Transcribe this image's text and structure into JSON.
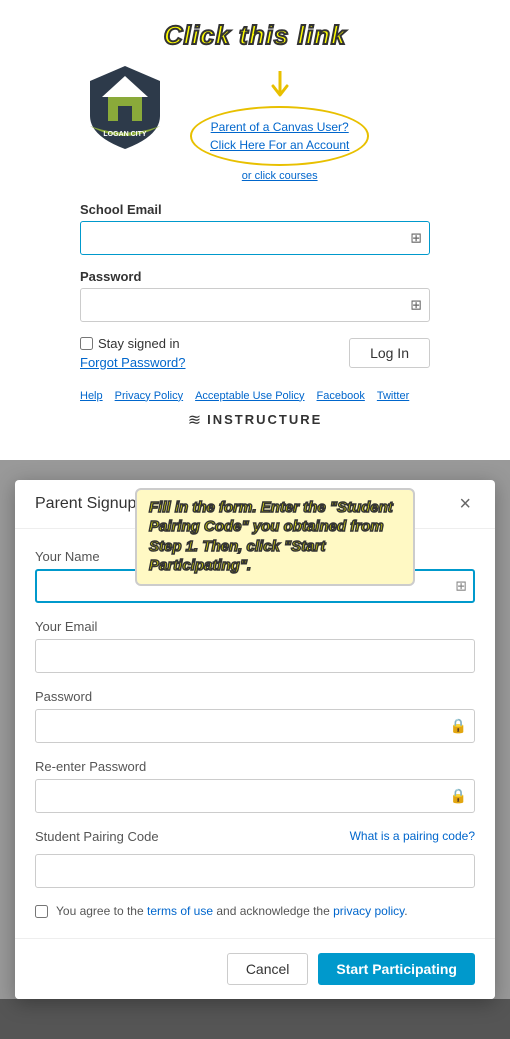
{
  "annotation": {
    "click_link": "Click this link",
    "fill_form": "Fill in the form. Enter the \"Student Pairing Code\" you obtained from Step 1. Then, click \"Start Participating\"."
  },
  "login": {
    "parent_link_line1": "Parent of a Canvas User?",
    "parent_link_line2": "Click Here For an Account",
    "enroll_link": "or click courses",
    "school_email_label": "School Email",
    "school_email_placeholder": "",
    "password_label": "Password",
    "stay_signed_label": "Stay signed in",
    "forgot_password": "Forgot Password?",
    "login_button": "Log In",
    "footer": {
      "help": "Help",
      "privacy_policy": "Privacy Policy",
      "acceptable_use": "Acceptable Use Policy",
      "facebook": "Facebook",
      "twitter": "Twitter"
    },
    "instructure_label": "INSTRUCTURE"
  },
  "modal": {
    "title": "Parent Signup",
    "close_icon": "×",
    "your_name_label": "Your Name",
    "your_email_label": "Your Email",
    "password_label": "Password",
    "re_enter_password_label": "Re-enter Password",
    "student_pairing_label": "Student Pairing Code",
    "what_is_link": "What is a pairing code?",
    "terms_text1": "You agree to the",
    "terms_link1": "terms of use",
    "terms_text2": "and acknowledge the",
    "terms_link2": "privacy policy",
    "terms_end": ".",
    "cancel_button": "Cancel",
    "start_button": "Start Participating"
  }
}
